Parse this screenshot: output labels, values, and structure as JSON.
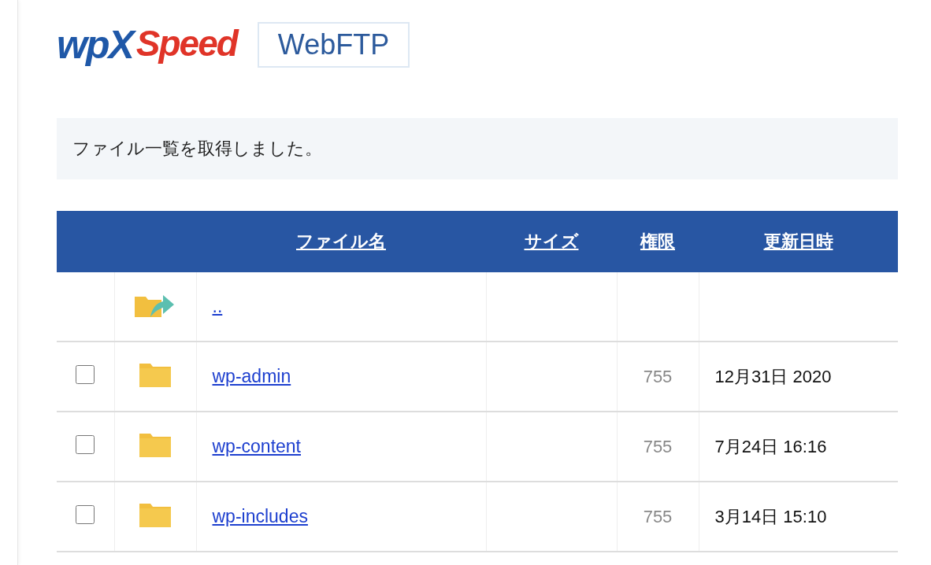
{
  "logo": {
    "primary": "wpX",
    "secondary": "Speed"
  },
  "app_badge": "WebFTP",
  "message": "ファイル一覧を取得しました。",
  "table": {
    "columns": [
      "ファイル名",
      "サイズ",
      "権限",
      "更新日時"
    ],
    "rows": [
      {
        "kind": "parent",
        "name": ".."
      },
      {
        "kind": "folder",
        "checked": false,
        "name": "wp-admin",
        "permission": "755",
        "modified": "12月31日 2020"
      },
      {
        "kind": "folder",
        "checked": false,
        "name": "wp-content",
        "permission": "755",
        "modified": "7月24日 16:16"
      },
      {
        "kind": "folder",
        "checked": false,
        "name": "wp-includes",
        "permission": "755",
        "modified": "3月14日 15:10"
      }
    ]
  }
}
